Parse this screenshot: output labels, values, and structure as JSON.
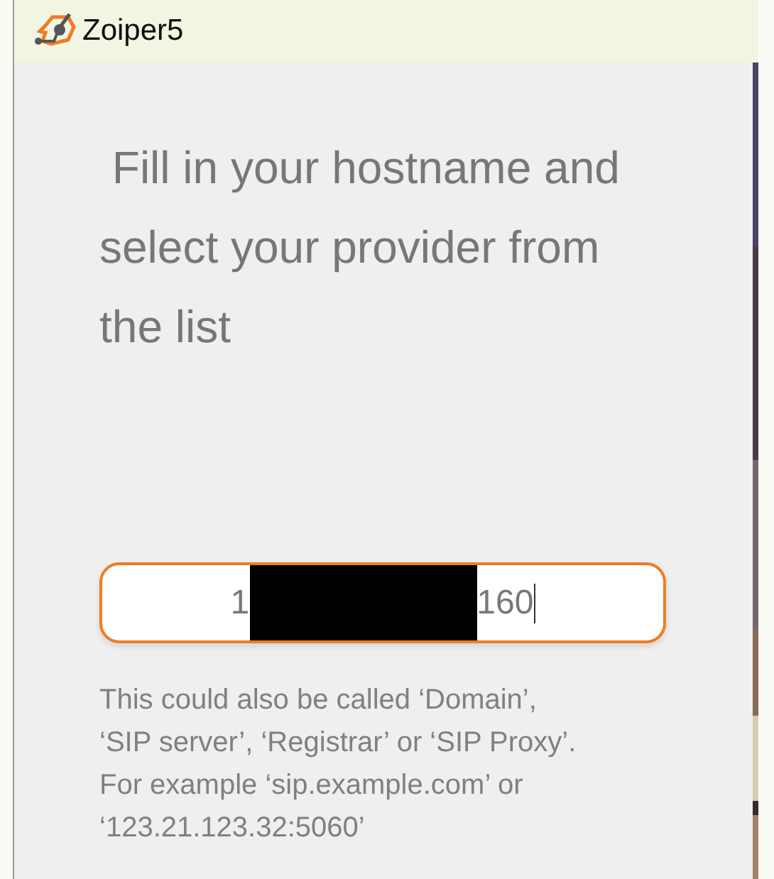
{
  "window": {
    "title": "Zoiper5"
  },
  "heading": " Fill in your hostname and select your provider from the list",
  "hostname_field": {
    "value_parts": [
      "1",
      "160"
    ],
    "redacted": true,
    "focused": true
  },
  "hint": "This could also be called ‘Domain’, ‘SIP server’, ‘Registrar’ or ‘SIP Proxy’. For example ‘sip.example.com’ or ‘123.21.123.32:5060’"
}
